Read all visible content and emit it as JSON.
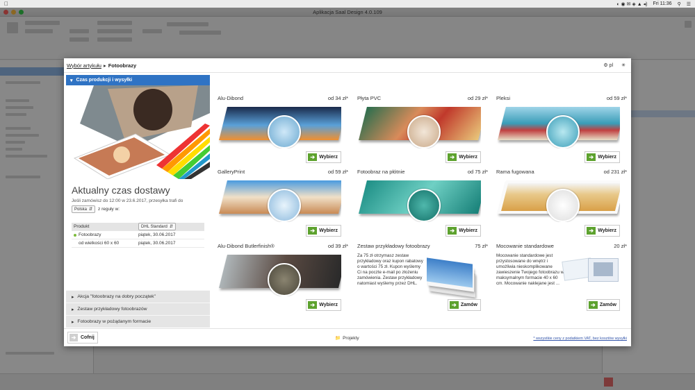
{
  "menubar": {
    "time": "Fri 11:36"
  },
  "window": {
    "title": "Aplikacja Saal Design 4.0.109"
  },
  "dialog": {
    "breadcrumb_link": "Wybór artykułu",
    "breadcrumb_current": "Fotoobrazy",
    "language": "pl"
  },
  "left_panel": {
    "section_title": "Czas produkcji i wysyłki",
    "delivery_title": "Aktualny czas dostawy",
    "delivery_text": "Jeśli zamówisz do 12:00 w 23.6.2017, przesyłka trafi do",
    "country": "Polska",
    "rule_text": "z reguły w:",
    "table": {
      "header_product": "Produkt",
      "shipping_method": "DHL Standard",
      "rows": [
        {
          "product": "Fotoobrazy",
          "date": "piątek, 30.06.2017"
        },
        {
          "product": "od wielkości 60 x 60",
          "date": "piątek, 30.06.2017"
        }
      ]
    },
    "accordion": [
      "Akcja \"fotoobrazy na dobry początek\"",
      "Zestaw przykładowy fotoobrazów",
      "Fotoobrazy w pożądanym formacie"
    ]
  },
  "products": [
    {
      "name": "Alu-Dibond",
      "price": "od 34 zł*",
      "button": "Wybierz"
    },
    {
      "name": "Płyta PVC",
      "price": "od 29 zł*",
      "button": "Wybierz"
    },
    {
      "name": "Pleksi",
      "price": "od 59 zł*",
      "button": "Wybierz"
    },
    {
      "name": "GalleryPrint",
      "price": "od 59 zł*",
      "button": "Wybierz"
    },
    {
      "name": "Fotoobraz na płótnie",
      "price": "od 75 zł*",
      "button": "Wybierz"
    },
    {
      "name": "Rama fugowana",
      "price": "od 231 zł*",
      "button": "Wybierz"
    },
    {
      "name": "Alu-Dibond Butlerfinish®",
      "price": "od 39 zł*",
      "button": "Wybierz"
    },
    {
      "name": "Zestaw przykładowy fotoobrazy",
      "price": "75 zł*",
      "button": "Zamów",
      "description": "Za 75 zł otrzymasz zestaw przykładowy oraz kupon rabatowy o wartości 75 zł. Kupon wyślemy Ci na poczte e-mail po złożeniu zamówienia. Zestaw przykładowy natomiast wyślemy przez DHL."
    },
    {
      "name": "Mocowanie standardowe",
      "price": "20 zł*",
      "button": "Zamów",
      "description": "Mocowanie standardowe jest przystosowane do wnętrz i umożliwia nieskomplikowane zawieszenie Twojego fotoobrazu w maksymalnym formacie 40 x 60 cm. Mocowanie naklejane jest ..."
    }
  ],
  "footer": {
    "back_label": "Cofnij",
    "projects_label": "Projekty",
    "vat_note": "* wszystkie ceny z podatkiem VAT, bez kosztów wysyłki"
  },
  "colors": {
    "accent_blue": "#2f73c4",
    "button_green": "#5da22e"
  }
}
